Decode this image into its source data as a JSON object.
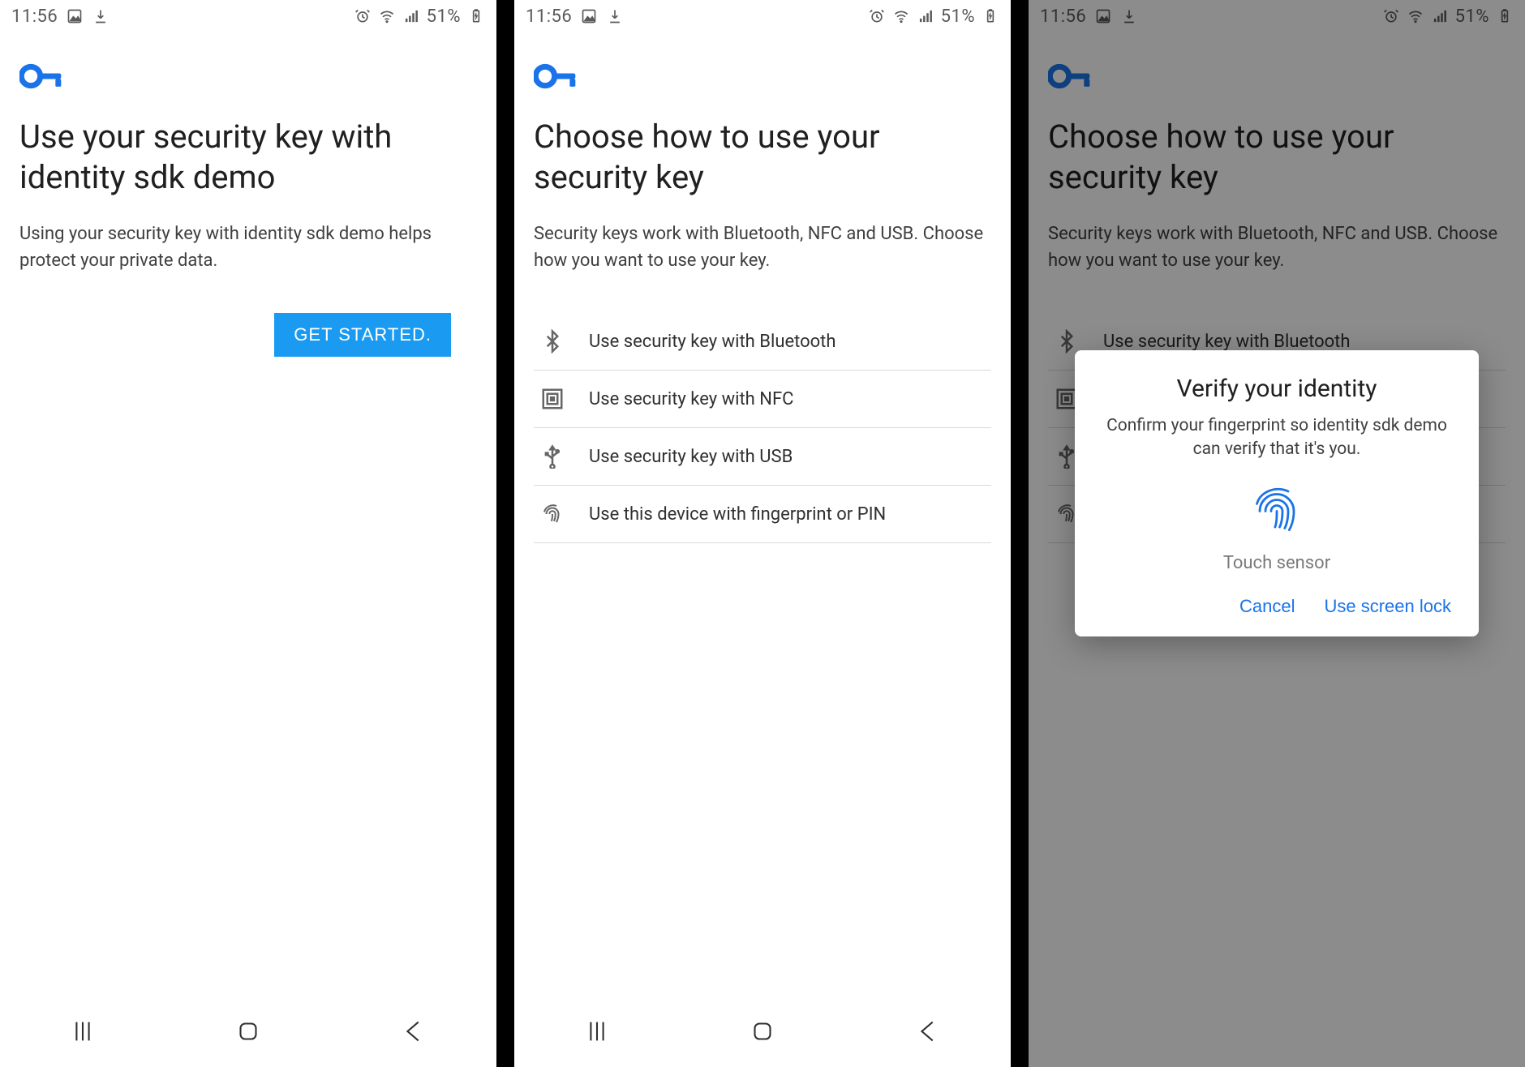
{
  "status_bar": {
    "time": "11:56",
    "battery_text": "51%"
  },
  "screen1": {
    "title": "Use your security key with identity sdk demo",
    "subhead": "Using your security key with identity sdk demo helps protect your private data.",
    "cta": "GET STARTED."
  },
  "screen2": {
    "title": "Choose how to use your security key",
    "subhead": "Security keys work with Bluetooth, NFC and USB. Choose how you want to use your key.",
    "options": [
      "Use security key with Bluetooth",
      "Use security key with NFC",
      "Use security key with USB",
      "Use this device with fingerprint or PIN"
    ]
  },
  "screen3": {
    "title": "Choose how to use your security key",
    "subhead": "Security keys work with Bluetooth, NFC and USB. Choose how you want to use your key.",
    "dialog": {
      "heading": "Verify your identity",
      "body": "Confirm your fingerprint so identity sdk demo can verify that it's you.",
      "prompt": "Touch sensor",
      "cancel": "Cancel",
      "alt": "Use screen lock"
    }
  }
}
